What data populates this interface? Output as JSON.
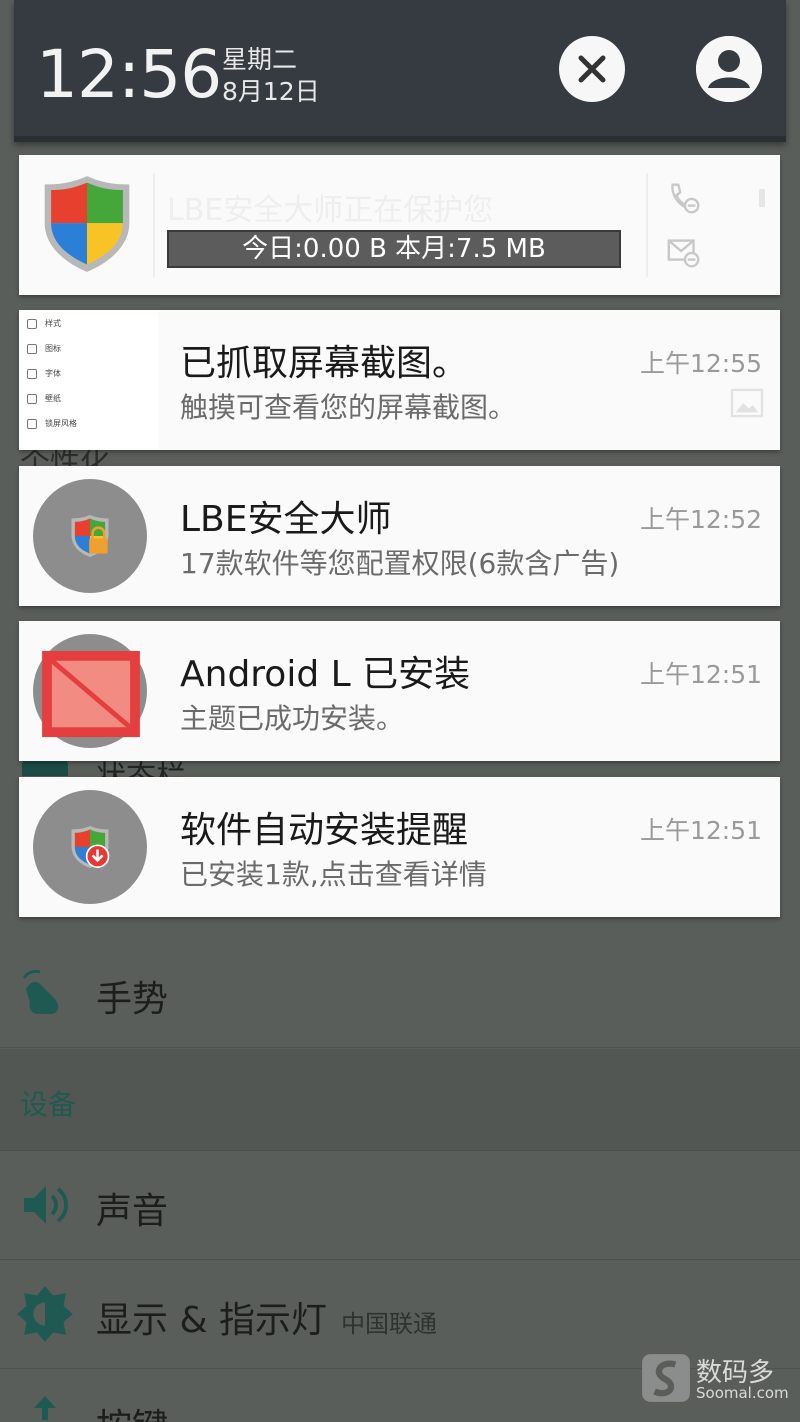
{
  "status": {
    "time": "12:56",
    "weekday": "星期二",
    "date": "8月12日"
  },
  "notifications": [
    {
      "title": "LBE安全大师正在保护您",
      "traffic": "今日:0.00 B 本月:7.5 MB"
    },
    {
      "title": "已抓取屏幕截图。",
      "text": "触摸可查看您的屏幕截图。",
      "time": "上午12:55",
      "thumb_items": [
        "样式",
        "图标",
        "字体",
        "壁纸",
        "锁屏风格"
      ]
    },
    {
      "title": "LBE安全大师",
      "text": "17款软件等您配置权限(6款含广告)",
      "time": "上午12:52"
    },
    {
      "title": "Android L 已安装",
      "text": "主题已成功安装。",
      "time": "上午12:51"
    },
    {
      "title": "软件自动安装提醒",
      "text": "已安装1款,点击查看详情",
      "time": "上午12:51"
    }
  ],
  "background": {
    "peek_personalize": "个性化",
    "peek_statusbar": "状态栏",
    "gesture": "手势",
    "section_device": "设备",
    "sound": "声音",
    "display": "显示 & 指示灯",
    "carrier": "中国联通",
    "keys": "按键"
  },
  "watermark": {
    "brand": "数码多",
    "site": "Soomal.com"
  },
  "colors": {
    "accent": "#1f5a52",
    "header_bg": "#353b40",
    "card_bg": "#fafafa",
    "traffic_bg": "#5c5c5c"
  }
}
